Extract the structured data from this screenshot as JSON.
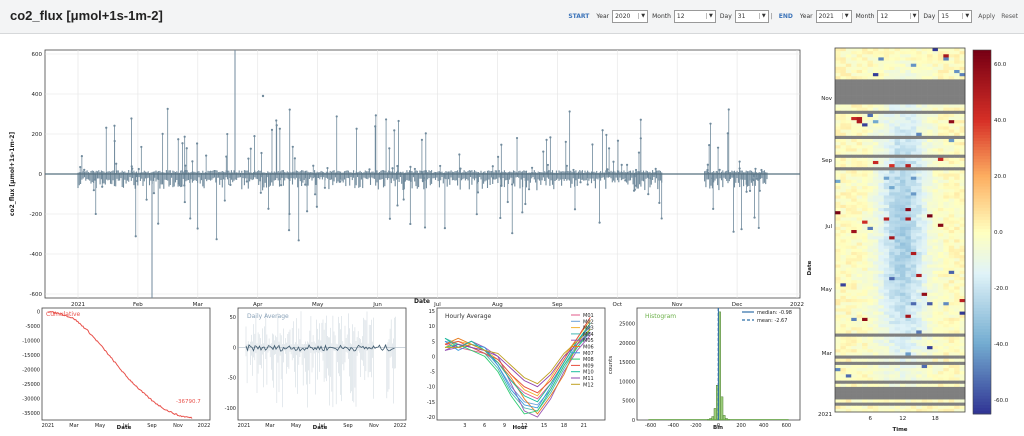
{
  "header": {
    "title": "co2_flux [μmol+1s-1m-2]",
    "start_label": "START",
    "end_label": "END",
    "separator": "|",
    "start": {
      "year_label": "Year",
      "year": "2020",
      "month_label": "Month",
      "month": "12",
      "day_label": "Day",
      "day": "31"
    },
    "end": {
      "year_label": "Year",
      "year": "2021",
      "month_label": "Month",
      "month": "12",
      "day_label": "Day",
      "day": "15"
    },
    "apply_label": "Apply",
    "reset_label": "Reset"
  },
  "colors": {
    "series": "#708a9c",
    "cumulative": "#e8504a",
    "daily_title": "#8aa2b8",
    "hourly_title": "#333333",
    "histogram_title": "#6bb048",
    "histogram_line": "#2e6fa8"
  },
  "chart_data": [
    {
      "type": "scatter",
      "name": "main-timeseries",
      "ylabel": "co2_flux [μmol+1s-1m-2]",
      "xlabel": "Date",
      "yticks": [
        600,
        400,
        200,
        0,
        -200,
        -400,
        -600
      ],
      "xticks": [
        "2021",
        "Feb",
        "Mar",
        "Apr",
        "May",
        "Jun",
        "Jul",
        "Aug",
        "Sep",
        "Oct",
        "Nov",
        "Dec",
        "2022"
      ],
      "ylim": [
        -620,
        620
      ],
      "gap": [
        "Oct 25",
        "Nov 25"
      ],
      "grid": true
    },
    {
      "type": "line",
      "name": "cumulative",
      "title": "Cumulative",
      "annotation": "-36790.7",
      "yticks": [
        0,
        -5000,
        -10000,
        -15000,
        -20000,
        -25000,
        -30000,
        -35000
      ],
      "xticks": [
        "2021",
        "Mar",
        "May",
        "Jul",
        "Sep",
        "Nov",
        "2022"
      ],
      "xlabel": "Date",
      "x": [
        "2021-01-01",
        "2021-02-01",
        "2021-03-01",
        "2021-04-01",
        "2021-05-01",
        "2021-06-01",
        "2021-07-01",
        "2021-08-01",
        "2021-09-01",
        "2021-10-01",
        "2021-11-01",
        "2021-12-15"
      ],
      "values": [
        0,
        -800,
        -2500,
        -6500,
        -11500,
        -17000,
        -22500,
        -27000,
        -31000,
        -34000,
        -36000,
        -36790.7
      ]
    },
    {
      "type": "line",
      "name": "daily-average",
      "title": "Daily Average",
      "yticks": [
        50,
        0,
        -50,
        -100
      ],
      "xticks": [
        "2021",
        "Mar",
        "May",
        "Jul",
        "Sep",
        "Nov",
        "2022"
      ],
      "xlabel": "Date",
      "ylim": [
        -120,
        65
      ]
    },
    {
      "type": "line",
      "name": "hourly-average",
      "title": "Hourly Average",
      "xlabel": "Hour",
      "xticks": [
        "3",
        "6",
        "9",
        "12",
        "15",
        "18",
        "21"
      ],
      "yticks": [
        15,
        10,
        5,
        0,
        -5,
        -10,
        -15,
        -20
      ],
      "ylim": [
        -21,
        16
      ],
      "x": [
        0,
        2,
        4,
        6,
        8,
        10,
        12,
        14,
        16,
        18,
        20,
        22
      ],
      "series": [
        {
          "name": "M01",
          "color": "#e05a8a",
          "values": [
            4,
            3,
            2,
            1,
            -2,
            -8,
            -12,
            -14,
            -9,
            -2,
            5,
            10
          ]
        },
        {
          "name": "M02",
          "color": "#6aa0d8",
          "values": [
            5,
            4,
            3,
            2,
            -3,
            -10,
            -15,
            -16,
            -11,
            -3,
            4,
            9
          ]
        },
        {
          "name": "M03",
          "color": "#f2b233",
          "values": [
            3,
            5,
            4,
            2,
            -1,
            -6,
            -11,
            -13,
            -7,
            0,
            6,
            12
          ]
        },
        {
          "name": "M04",
          "color": "#4ab8b0",
          "values": [
            6,
            4,
            3,
            1,
            -4,
            -12,
            -17,
            -18,
            -12,
            -4,
            3,
            8
          ]
        },
        {
          "name": "M05",
          "color": "#9b59b6",
          "values": [
            2,
            3,
            5,
            3,
            0,
            -9,
            -18,
            -20,
            -14,
            -5,
            2,
            7
          ]
        },
        {
          "name": "M06",
          "color": "#e67e22",
          "values": [
            4,
            6,
            4,
            2,
            -2,
            -7,
            -14,
            -19,
            -13,
            -6,
            4,
            11
          ]
        },
        {
          "name": "M07",
          "color": "#3498db",
          "values": [
            5,
            2,
            4,
            3,
            -3,
            -11,
            -16,
            -17,
            -10,
            -2,
            5,
            10
          ]
        },
        {
          "name": "M08",
          "color": "#2ecc71",
          "values": [
            3,
            4,
            2,
            0,
            -5,
            -13,
            -19,
            -18,
            -11,
            -3,
            3,
            9
          ]
        },
        {
          "name": "M09",
          "color": "#e74c3c",
          "values": [
            4,
            5,
            3,
            1,
            -1,
            -6,
            -10,
            -12,
            -8,
            -1,
            6,
            13
          ]
        },
        {
          "name": "M10",
          "color": "#1abc9c",
          "values": [
            6,
            3,
            5,
            2,
            -2,
            -8,
            -13,
            -15,
            -9,
            -2,
            5,
            11
          ]
        },
        {
          "name": "M11",
          "color": "#8e44ad",
          "values": [
            2,
            4,
            3,
            2,
            0,
            -4,
            -8,
            -10,
            -6,
            0,
            4,
            8
          ]
        },
        {
          "name": "M12",
          "color": "#c0a020",
          "values": [
            3,
            3,
            4,
            2,
            1,
            -3,
            -7,
            -9,
            -5,
            1,
            5,
            9
          ]
        }
      ]
    },
    {
      "type": "bar",
      "name": "histogram",
      "title": "Histogram",
      "xlabel": "Bin",
      "ylabel": "counts",
      "xticks": [
        "-600",
        "-400",
        "-200",
        "0",
        "200",
        "400",
        "600"
      ],
      "yticks": [
        25000,
        20000,
        15000,
        10000,
        5000,
        0
      ],
      "ylim": [
        0,
        29000
      ],
      "bins": [
        -100,
        -80,
        -60,
        -40,
        -20,
        0,
        20,
        40,
        60,
        80
      ],
      "values": [
        200,
        400,
        900,
        3000,
        9000,
        28000,
        6000,
        1200,
        400,
        150
      ],
      "legend": [
        {
          "label": "median: -0.98",
          "style": "solid"
        },
        {
          "label": "mean: -2.67",
          "style": "dashed"
        }
      ]
    },
    {
      "type": "heatmap",
      "name": "heatmap",
      "xlabel": "Time",
      "ylabel": "Date",
      "xticks": [
        "6",
        "12",
        "18"
      ],
      "yticks": [
        "Nov",
        "Sep",
        "Jul",
        "May",
        "Mar",
        "2021"
      ],
      "colorbar_ticks": [
        "60.0",
        "40.0",
        "20.0",
        "0.0",
        "-20.0",
        "-40.0",
        "-60.0"
      ],
      "colorbar_range": [
        -65,
        65
      ]
    }
  ]
}
